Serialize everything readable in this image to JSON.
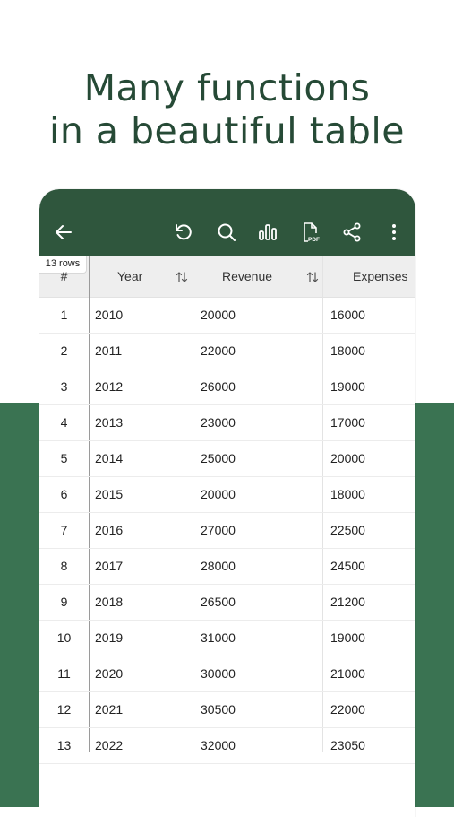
{
  "headline": {
    "line1": "Many functions",
    "line2": "in a beautiful table"
  },
  "toolbar": {
    "icons": [
      "back-arrow-icon",
      "undo-icon",
      "search-icon",
      "chart-icon",
      "pdf-icon",
      "share-icon",
      "more-vert-icon"
    ]
  },
  "table": {
    "row_count_label": "13 rows",
    "index_header": "#",
    "columns": [
      "Year",
      "Revenue",
      "Expenses"
    ],
    "rows": [
      {
        "num": "1",
        "year": "2010",
        "revenue": "20000",
        "expenses": "16000"
      },
      {
        "num": "2",
        "year": "2011",
        "revenue": "22000",
        "expenses": "18000"
      },
      {
        "num": "3",
        "year": "2012",
        "revenue": "26000",
        "expenses": "19000"
      },
      {
        "num": "4",
        "year": "2013",
        "revenue": "23000",
        "expenses": "17000"
      },
      {
        "num": "5",
        "year": "2014",
        "revenue": "25000",
        "expenses": "20000"
      },
      {
        "num": "6",
        "year": "2015",
        "revenue": "20000",
        "expenses": "18000"
      },
      {
        "num": "7",
        "year": "2016",
        "revenue": "27000",
        "expenses": "22500"
      },
      {
        "num": "8",
        "year": "2017",
        "revenue": "28000",
        "expenses": "24500"
      },
      {
        "num": "9",
        "year": "2018",
        "revenue": "26500",
        "expenses": "21200"
      },
      {
        "num": "10",
        "year": "2019",
        "revenue": "31000",
        "expenses": "19000"
      },
      {
        "num": "11",
        "year": "2020",
        "revenue": "30000",
        "expenses": "21000"
      },
      {
        "num": "12",
        "year": "2021",
        "revenue": "30500",
        "expenses": "22000"
      },
      {
        "num": "13",
        "year": "2022",
        "revenue": "32000",
        "expenses": "23050"
      }
    ]
  },
  "colors": {
    "toolbar": "#2f563d",
    "headline": "#264a36",
    "band": "#3a7352"
  }
}
